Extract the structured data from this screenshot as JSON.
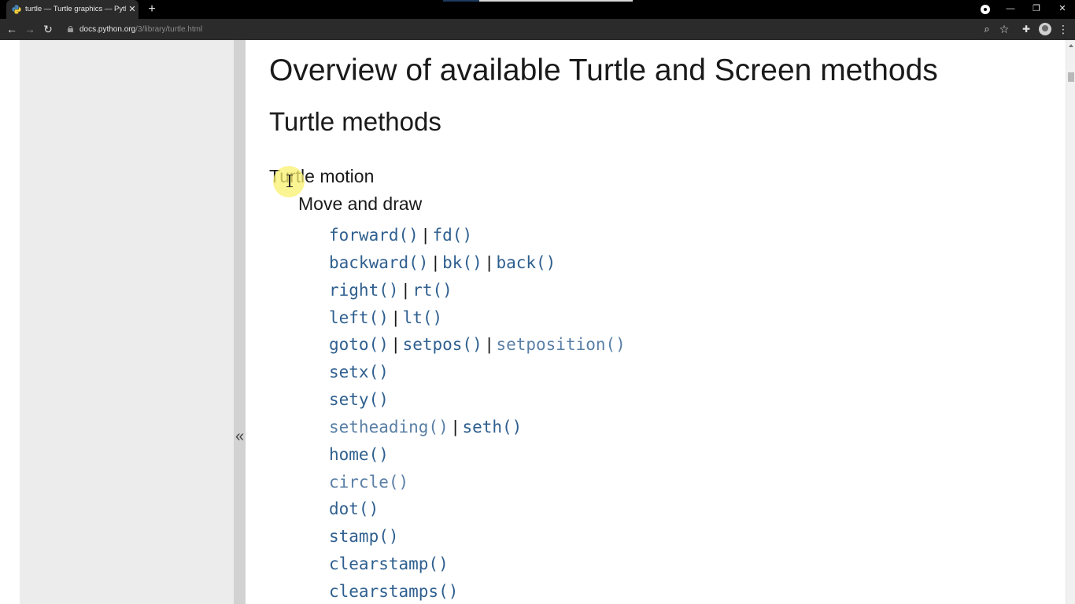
{
  "browser": {
    "tab_title": "turtle — Turtle graphics — Python",
    "tab_close": "✕",
    "new_tab": "+",
    "url_host": "docs.python.org",
    "url_path": "/3/library/turtle.html",
    "minimize": "—",
    "restore": "❐",
    "close": "✕",
    "back": "←",
    "forward": "→",
    "reload": "↻",
    "zoom": "⌕",
    "bookmark": "☆",
    "extensions": "✚",
    "menu": "⋮"
  },
  "sidebar": {
    "collapse_label": "«"
  },
  "doc": {
    "h1": "Overview of available Turtle and Screen methods",
    "h2": "Turtle methods",
    "h3": "Turtle motion",
    "h4": "Move and draw",
    "methods": [
      [
        "forward()",
        "fd()"
      ],
      [
        "backward()",
        "bk()",
        "back()"
      ],
      [
        "right()",
        "rt()"
      ],
      [
        "left()",
        "lt()"
      ],
      [
        "goto()",
        "setpos()",
        "setposition()"
      ],
      [
        "setx()"
      ],
      [
        "sety()"
      ],
      [
        "setheading()",
        "seth()"
      ],
      [
        "home()"
      ],
      [
        "circle()"
      ],
      [
        "dot()"
      ],
      [
        "stamp()"
      ],
      [
        "clearstamp()"
      ],
      [
        "clearstamps()"
      ]
    ],
    "separator": "|"
  },
  "colors": {
    "link": "#2e5f8f",
    "link_visited": "#5a7fa6",
    "sidebar_bg": "#ececec",
    "chrome_bg": "#2b2b2b"
  },
  "icons": {
    "tab_favicon": "python-logo-icon",
    "lock": "lock-icon",
    "profile": "profile-icon",
    "avatar": "avatar-icon"
  }
}
